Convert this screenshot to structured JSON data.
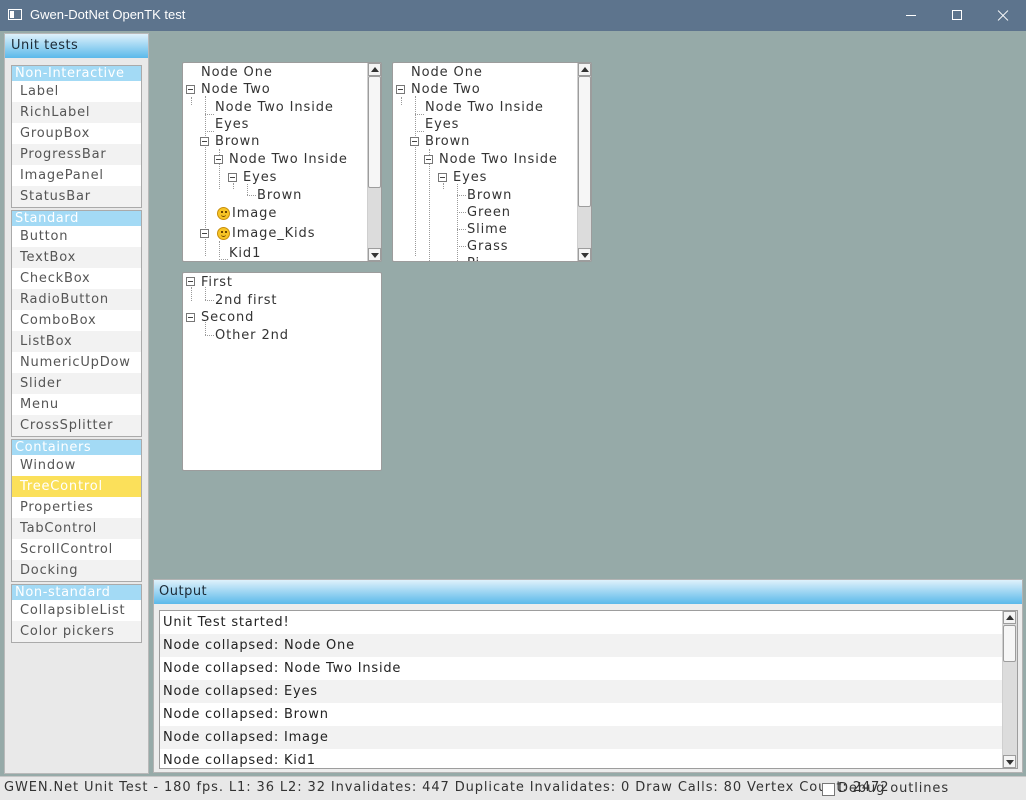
{
  "window": {
    "title": "Gwen-DotNet OpenTK test"
  },
  "left_panel": {
    "title": "Unit tests",
    "categories": [
      {
        "header": "Non-Interactive",
        "items": [
          "Label",
          "RichLabel",
          "GroupBox",
          "ProgressBar",
          "ImagePanel",
          "StatusBar"
        ]
      },
      {
        "header": "Standard",
        "items": [
          "Button",
          "TextBox",
          "CheckBox",
          "RadioButton",
          "ComboBox",
          "ListBox",
          "NumericUpDow",
          "Slider",
          "Menu",
          "CrossSplitter"
        ]
      },
      {
        "header": "Containers",
        "items": [
          "Window",
          "TreeControl",
          "Properties",
          "TabControl",
          "ScrollControl",
          "Docking"
        ]
      },
      {
        "header": "Non-standard",
        "items": [
          "CollapsibleList",
          "Color pickers"
        ]
      }
    ],
    "selected_item": "TreeControl"
  },
  "trees": [
    {
      "nodes": [
        {
          "label": "Node One",
          "toggle": false,
          "icon": null
        },
        {
          "label": "Node Two",
          "toggle": true,
          "icon": null
        },
        {
          "label": "Node Two Inside",
          "toggle": false,
          "icon": null
        },
        {
          "label": "Eyes",
          "toggle": false,
          "icon": null
        },
        {
          "label": "Brown",
          "toggle": true,
          "icon": null
        },
        {
          "label": "Node Two Inside",
          "toggle": true,
          "icon": null
        },
        {
          "label": "Eyes",
          "toggle": true,
          "icon": null
        },
        {
          "label": "Brown",
          "toggle": false,
          "icon": null
        },
        {
          "label": "Image",
          "toggle": false,
          "icon": "smiley-icon"
        },
        {
          "label": "Image_Kids",
          "toggle": true,
          "icon": "smiley-icon"
        },
        {
          "label": "Kid1",
          "toggle": false,
          "icon": null
        }
      ]
    },
    {
      "nodes": [
        {
          "label": "Node One",
          "toggle": false
        },
        {
          "label": "Node Two",
          "toggle": true
        },
        {
          "label": "Node Two Inside",
          "toggle": false
        },
        {
          "label": "Eyes",
          "toggle": false
        },
        {
          "label": "Brown",
          "toggle": true
        },
        {
          "label": "Node Two Inside",
          "toggle": true
        },
        {
          "label": "Eyes",
          "toggle": true
        },
        {
          "label": "Brown",
          "toggle": false
        },
        {
          "label": "Green",
          "toggle": false
        },
        {
          "label": "Slime",
          "toggle": false
        },
        {
          "label": "Grass",
          "toggle": false
        },
        {
          "label": "Pi",
          "toggle": false
        }
      ]
    },
    {
      "nodes": [
        {
          "label": "First",
          "toggle": true
        },
        {
          "label": "2nd first",
          "toggle": false
        },
        {
          "label": "Second",
          "toggle": true
        },
        {
          "label": "Other 2nd",
          "toggle": false
        }
      ]
    }
  ],
  "output": {
    "title": "Output",
    "lines": [
      "Unit Test started!",
      "Node collapsed: Node One",
      "Node collapsed: Node Two Inside",
      "Node collapsed: Eyes",
      "Node collapsed: Brown",
      "Node collapsed: Image",
      "Node collapsed: Kid1"
    ]
  },
  "status": {
    "text": "GWEN.Net Unit Test - 180 fps. L1: 36 L2: 32 Invalidates: 447 Duplicate Invalidates: 0 Draw Calls: 80 Vertex Count: 2472",
    "debug_label": "Debug outlines",
    "debug_checked": false
  },
  "colors": {
    "accent": "#5bb9ea",
    "selected": "#fbe05a",
    "background": "#96aaa8",
    "titlebar": "#5d748d"
  }
}
